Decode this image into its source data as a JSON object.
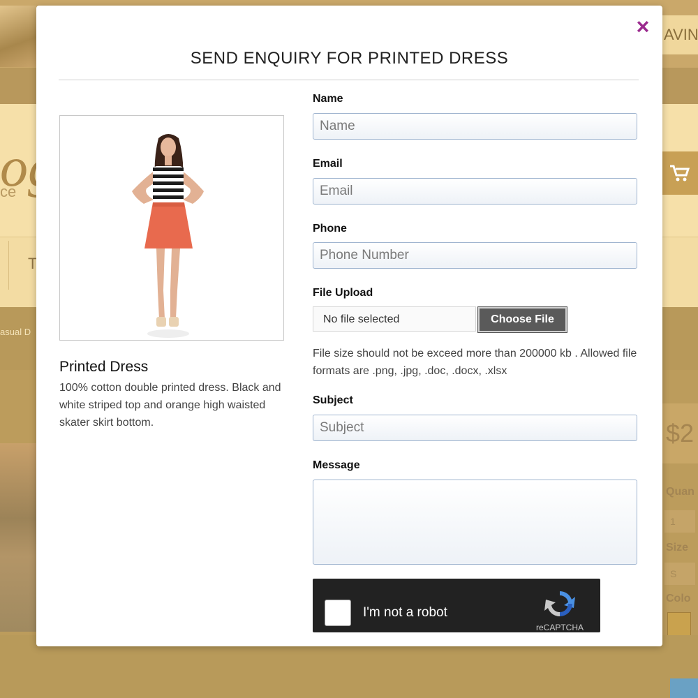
{
  "background": {
    "saving_fragment": "AVING",
    "logo_fragment": "og",
    "logo_sub_fragment": "ce",
    "nav_fragment": "T",
    "breadcrumb_fragment": "asual D",
    "price_fragment": "$2",
    "quantity_label_fragment": "Quan",
    "quantity_value": "1",
    "size_label_fragment": "Size",
    "size_value": "S",
    "color_label_fragment": "Colo"
  },
  "modal": {
    "title": "SEND ENQUIRY FOR PRINTED DRESS",
    "close_glyph": "×",
    "product": {
      "name": "Printed Dress",
      "description": "100% cotton double printed dress. Black and white striped top and orange high waisted skater skirt bottom."
    },
    "form": {
      "name": {
        "label": "Name",
        "placeholder": "Name"
      },
      "email": {
        "label": "Email",
        "placeholder": "Email"
      },
      "phone": {
        "label": "Phone",
        "placeholder": "Phone Number"
      },
      "file": {
        "label": "File Upload",
        "status": "No file selected",
        "button": "Choose File",
        "help": "File size should not be exceed more than 200000 kb . Allowed file formats are .png, .jpg, .doc, .docx, .xlsx"
      },
      "subject": {
        "label": "Subject",
        "placeholder": "Subject"
      },
      "message": {
        "label": "Message",
        "placeholder": ""
      }
    },
    "captcha": {
      "label": "I'm not a robot",
      "brand": "reCAPTCHA"
    }
  },
  "colors": {
    "overlay_bg": "#b89a5a",
    "close_icon": "#9b2a8e",
    "input_border": "#9fb4cf",
    "captcha_bg": "#222222",
    "file_button_bg": "#5a5a5a"
  }
}
